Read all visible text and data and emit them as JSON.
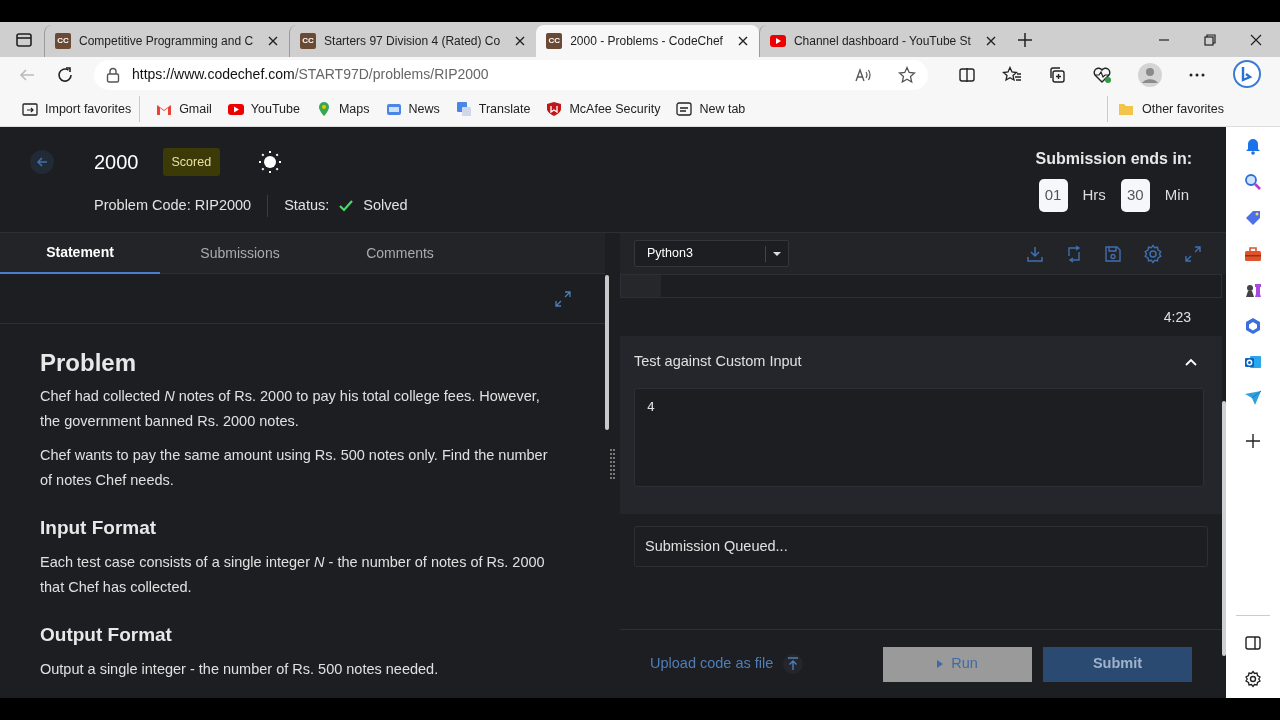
{
  "browser": {
    "tabs": [
      {
        "kind": "codechef",
        "icon_text": "CC",
        "title": "Competitive Programming and C",
        "selected": false
      },
      {
        "kind": "codechef",
        "icon_text": "CC",
        "title": "Starters 97 Division 4 (Rated) Co",
        "selected": false
      },
      {
        "kind": "codechef",
        "icon_text": "CC",
        "title": "2000 - Problems - CodeChef",
        "selected": true
      },
      {
        "kind": "youtube",
        "title": "Channel dashboard - YouTube St",
        "selected": false
      }
    ],
    "url_host": "https://www.codechef.com",
    "url_path": "/START97D/problems/RIP2000",
    "bookmarks": [
      {
        "kind": "import",
        "label": "Import favorites"
      },
      {
        "kind": "gmail",
        "label": "Gmail"
      },
      {
        "kind": "youtube",
        "label": "YouTube"
      },
      {
        "kind": "maps",
        "label": "Maps"
      },
      {
        "kind": "news",
        "label": "News"
      },
      {
        "kind": "translate",
        "label": "Translate"
      },
      {
        "kind": "mcafee",
        "label": "McAfee Security"
      },
      {
        "kind": "newtab",
        "label": "New tab"
      }
    ],
    "other_favorites": "Other favorites"
  },
  "header": {
    "title": "2000",
    "badge": "Scored",
    "problem_code": "Problem Code: RIP2000",
    "status_label": "Status:",
    "status": "Solved",
    "timer_label": "Submission ends in:",
    "hours": "01",
    "hours_unit": "Hrs",
    "minutes": "30",
    "minutes_unit": "Min"
  },
  "tabs": [
    {
      "label": "Statement",
      "selected": true
    },
    {
      "label": "Submissions",
      "selected": false
    },
    {
      "label": "Comments",
      "selected": false
    }
  ],
  "statement": [
    {
      "kind": "heading",
      "text": "Problem"
    },
    {
      "kind": "para",
      "text": "Chef had collected *N* notes of Rs. 2000 to pay his total college fees. However, the government banned Rs. 2000 notes."
    },
    {
      "kind": "para",
      "text": "Chef wants to pay the same amount using Rs. 500 notes only. Find the number of notes Chef needs."
    },
    {
      "kind": "heading",
      "text": "Input Format"
    },
    {
      "kind": "para",
      "text": "Each test case consists of a single integer *N* - the number of notes of Rs. 2000 that Chef has collected."
    },
    {
      "kind": "heading",
      "text": "Output Format"
    },
    {
      "kind": "para",
      "text": "Output a single integer - the number of Rs. 500 notes needed."
    }
  ],
  "editor": {
    "language": "Python3",
    "cursor_position": "4:23",
    "custom_input_title": "Test against Custom Input",
    "custom_input_expanded": true,
    "custom_input": "4",
    "result": "Submission Queued...",
    "upload_link": "Upload code as file",
    "run_button": "Run",
    "submit_button": "Submit"
  }
}
